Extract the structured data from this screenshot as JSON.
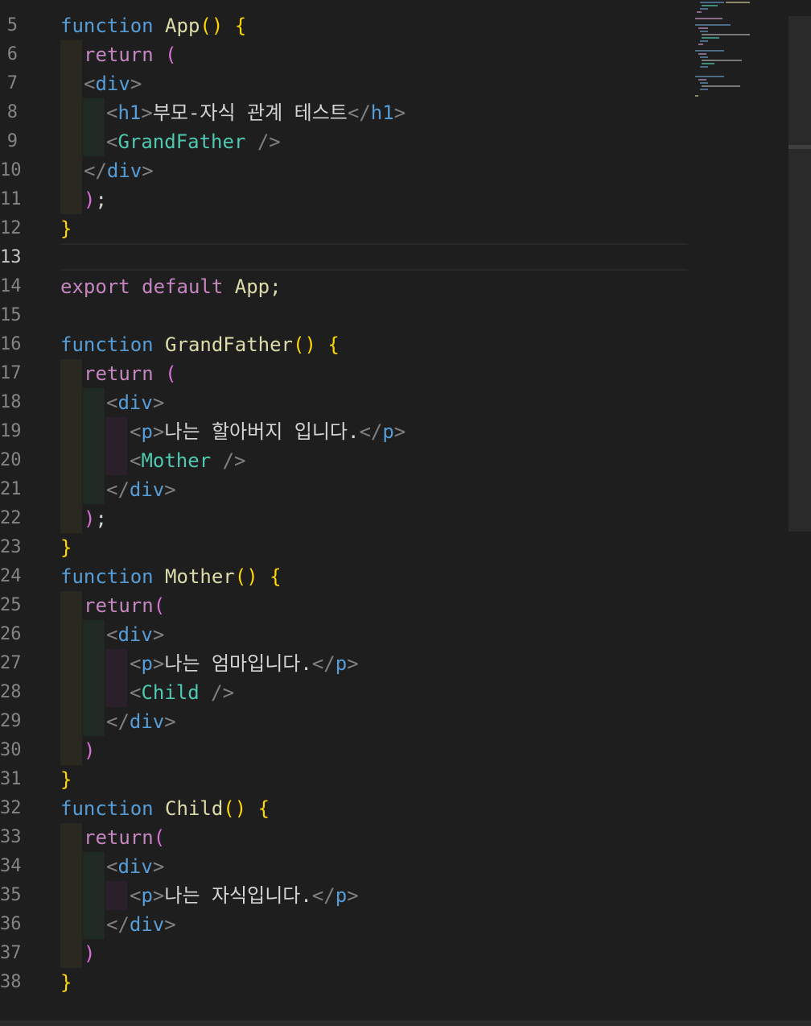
{
  "editor": {
    "line_numbers": [
      "5",
      "6",
      "7",
      "8",
      "9",
      "10",
      "11",
      "12",
      "13",
      "14",
      "15",
      "16",
      "17",
      "18",
      "19",
      "20",
      "21",
      "22",
      "23",
      "24",
      "25",
      "26",
      "27",
      "28",
      "29",
      "30",
      "31",
      "32",
      "33",
      "34",
      "35",
      "36",
      "37",
      "38"
    ],
    "active_line": "13",
    "tokens": {
      "function": "function",
      "return": "return",
      "export": "export",
      "default": "default",
      "app": "App",
      "app_semicolon": "App;",
      "grandfather": "GrandFather",
      "mother": "Mother",
      "child": "Child",
      "div": "div",
      "h1": "h1",
      "p": "p",
      "h1_text": "부모-자식 관계 테스트",
      "grandfather_text": "나는 할아버지 입니다.",
      "mother_text": "나는 엄마입니다.",
      "child_text": "나는 자식입니다."
    }
  },
  "colors": {
    "background": "#1e1e1e",
    "keyword": "#569cd6",
    "control": "#c586c0",
    "function_name": "#dcdcaa",
    "component": "#4ec9b0",
    "bracket_gold": "#ffd700",
    "bracket_magenta": "#da70d6",
    "angle_bracket": "#808080",
    "line_number": "#858585"
  },
  "icons": {
    "minimap": "minimap-preview",
    "scrollbar": "vertical-scrollbar"
  }
}
